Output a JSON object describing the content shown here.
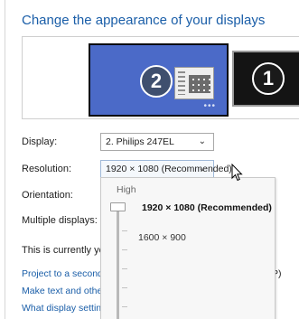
{
  "page": {
    "title": "Change the appearance of your displays"
  },
  "preview": {
    "monitors": [
      {
        "number": "2",
        "selected": true,
        "color": "#4b6ac8"
      },
      {
        "number": "1",
        "selected": false,
        "color": "#141414"
      }
    ],
    "dots": "•••"
  },
  "settings": {
    "display": {
      "label": "Display:",
      "value": "2. Philips 247EL"
    },
    "resolution": {
      "label": "Resolution:",
      "value": "1920 × 1080 (Recommended)"
    },
    "orientation": {
      "label": "Orientation:"
    },
    "multiple_displays": {
      "label": "Multiple displays:"
    }
  },
  "resolution_dropdown": {
    "high_label": "High",
    "options": [
      {
        "label": "1920 × 1080 (Recommended)",
        "selected": true
      },
      {
        "label": "1600 × 900",
        "selected": false
      }
    ]
  },
  "info_text": "This is currently you",
  "links": {
    "project": "Project to a second",
    "project_suffix": "P)",
    "make_text": "Make text and other",
    "what_settings": "What display setting"
  },
  "icons": {
    "dropdown_chevron": "chevron-down-icon",
    "cursor": "arrow-cursor-icon",
    "display_panel": "display-settings-icon"
  },
  "colors": {
    "accent": "#1a5ea8",
    "selected_monitor": "#4b6ac8"
  }
}
